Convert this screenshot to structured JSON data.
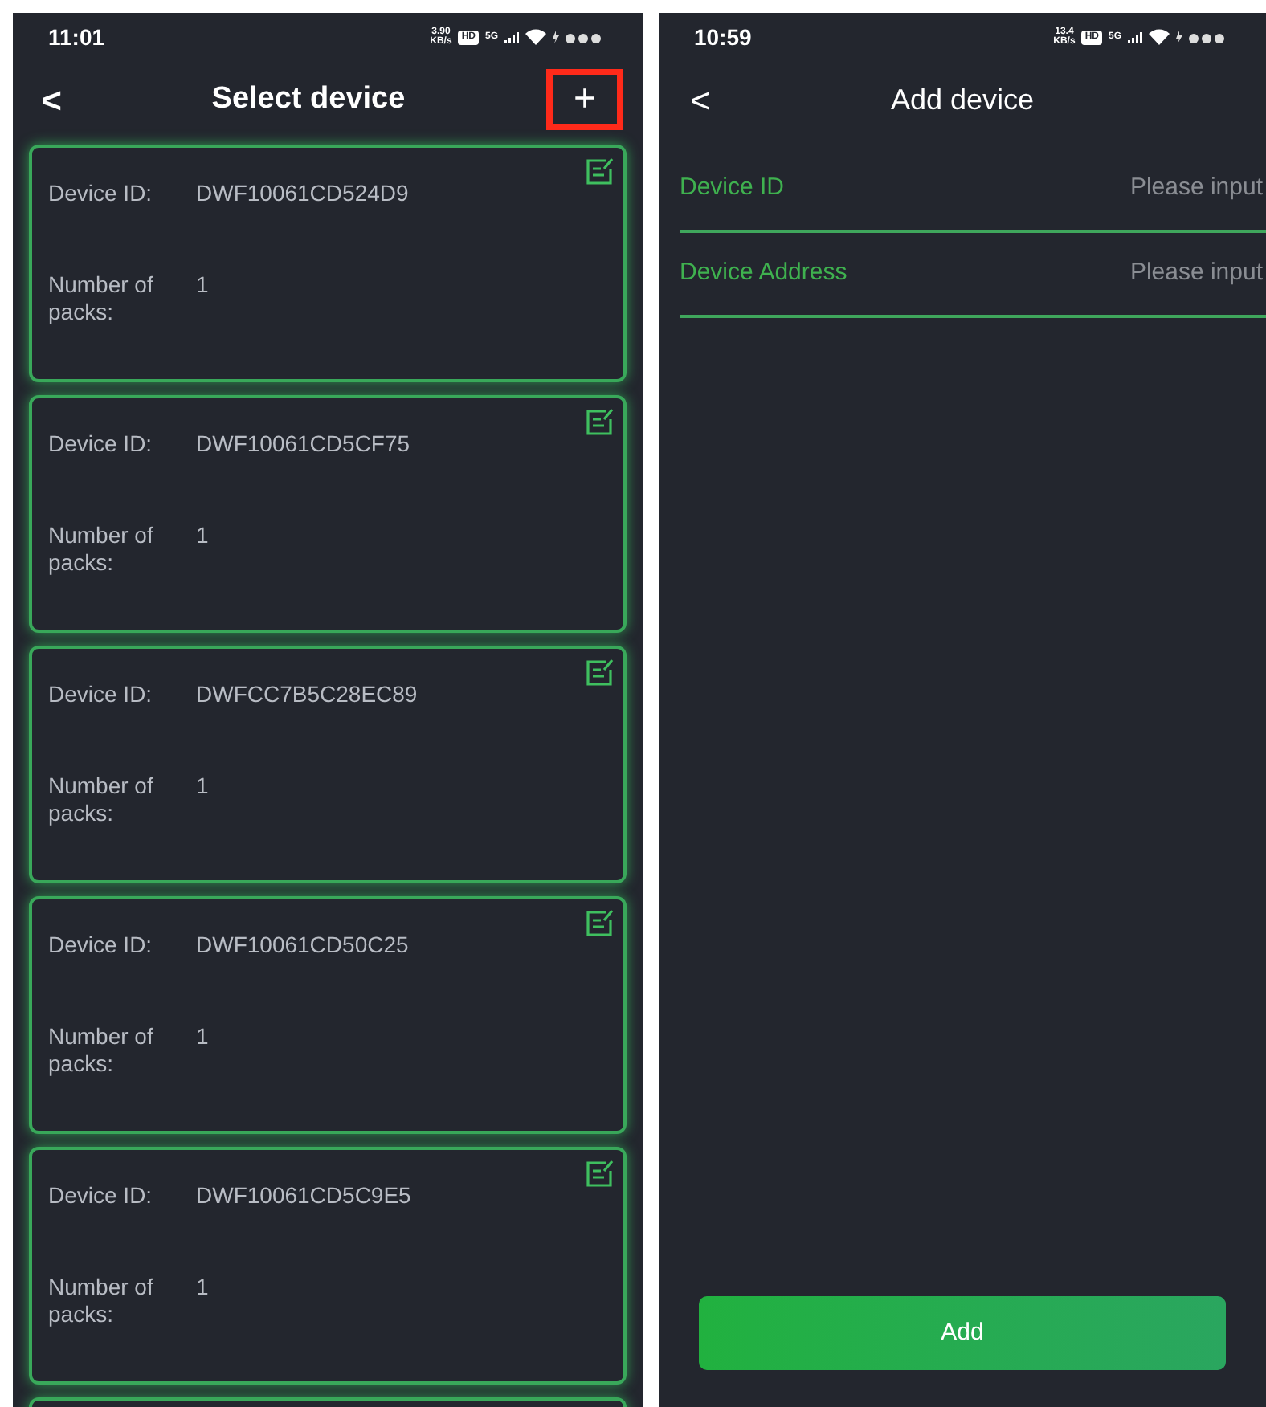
{
  "screens": [
    {
      "kind": "list",
      "status_bar": {
        "time": "11:01",
        "speed": [
          "3.90",
          "KB/s"
        ],
        "hd": "HD",
        "network": "5G"
      },
      "nav": {
        "back": "<",
        "title": "Select device",
        "action": "+",
        "action_highlighted": true
      },
      "devices": [
        {
          "id_label": "Device ID:",
          "id": "DWF10061CD524D9",
          "packs_label": "Number of packs:",
          "packs": "1"
        },
        {
          "id_label": "Device ID:",
          "id": "DWF10061CD5CF75",
          "packs_label": "Number of packs:",
          "packs": "1"
        },
        {
          "id_label": "Device ID:",
          "id": "DWFCC7B5C28EC89",
          "packs_label": "Number of packs:",
          "packs": "1"
        },
        {
          "id_label": "Device ID:",
          "id": "DWF10061CD50C25",
          "packs_label": "Number of packs:",
          "packs": "1"
        },
        {
          "id_label": "Device ID:",
          "id": "DWF10061CD5C9E5",
          "packs_label": "Number of packs:",
          "packs": "1"
        }
      ]
    },
    {
      "kind": "form",
      "status_bar": {
        "time": "10:59",
        "speed": [
          "13.4",
          "KB/s"
        ],
        "hd": "HD",
        "network": "5G"
      },
      "nav": {
        "back": "<",
        "title": "Add device"
      },
      "fields": [
        {
          "label": "Device ID",
          "placeholder": "Please input"
        },
        {
          "label": "Device Address",
          "placeholder": "Please input"
        }
      ],
      "submit": "Add"
    }
  ]
}
